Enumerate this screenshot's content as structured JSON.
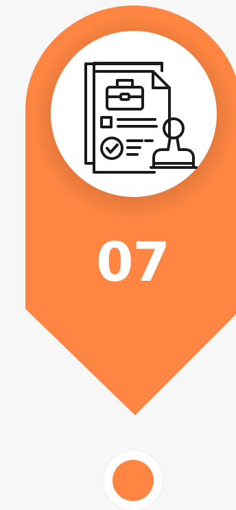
{
  "step": {
    "number": "07",
    "icon": "document-approval-stamp-icon",
    "accent_color": "#ff8642",
    "accent_shadow_color": "#e9703a",
    "text_color": "#ffffff",
    "icon_stroke_color": "#1a1a1a"
  }
}
